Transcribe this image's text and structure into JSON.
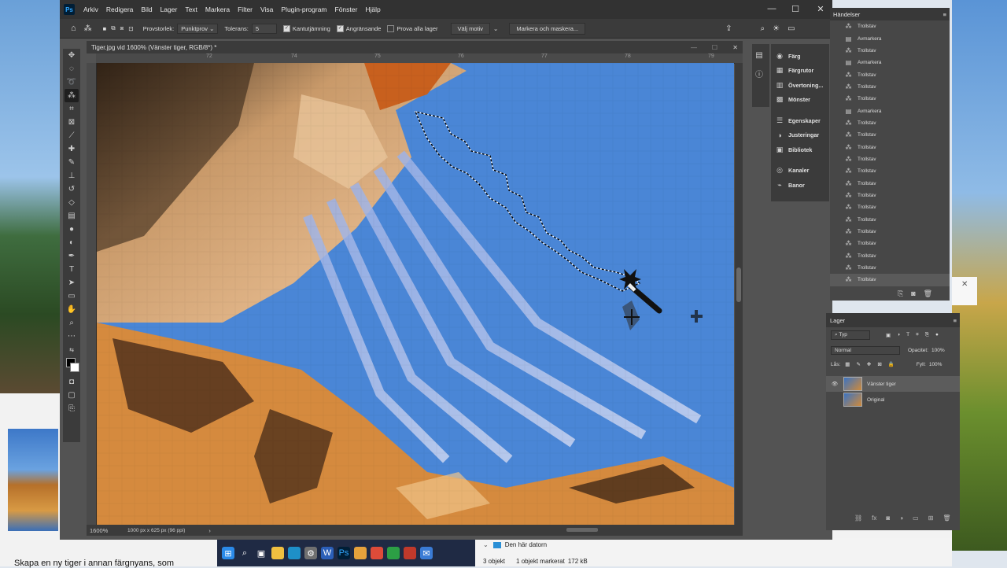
{
  "desktop": {
    "web_caption": "Skapa en ny tiger i annan färgnyans, som"
  },
  "taskbar": {
    "icons": [
      "windows-start-icon",
      "search-icon",
      "task-view-icon",
      "file-explorer-icon",
      "edge-icon",
      "settings-icon",
      "word-icon",
      "photoshop-icon",
      "folder-icon",
      "chrome-icon",
      "store-icon",
      "app-icon",
      "mail-icon"
    ]
  },
  "explorer": {
    "tree_item": "Den här datorn",
    "count": "3 objekt",
    "selected": "1 objekt markerat",
    "size": "172 kB"
  },
  "photoshop": {
    "menu": [
      "Arkiv",
      "Redigera",
      "Bild",
      "Lager",
      "Text",
      "Markera",
      "Filter",
      "Visa",
      "Plugin-program",
      "Fönster",
      "Hjälp"
    ],
    "options": {
      "sample_size_label": "Provstorlek:",
      "sample_size_value": "Punktprov",
      "tolerance_label": "Tolerans:",
      "tolerance_value": "5",
      "anti_alias": "Kantutjämning",
      "anti_alias_checked": true,
      "contiguous": "Angränsande",
      "contiguous_checked": true,
      "sample_all": "Prova alla lager",
      "sample_all_checked": false,
      "select_subject": "Välj motiv",
      "select_mask": "Markera och maskera..."
    },
    "document": {
      "title": "Tiger.jpg vid 1600% (Vänster tiger, RGB/8*) *",
      "zoom": "1600%",
      "doc_info": "1000 px x 625 px (96 ppi)",
      "ruler_ticks": [
        "72",
        "73",
        "74",
        "75",
        "76",
        "77",
        "78",
        "79"
      ]
    },
    "side_panels": [
      {
        "icon": "color-icon",
        "label": "Färg"
      },
      {
        "icon": "swatches-icon",
        "label": "Färgrutor"
      },
      {
        "icon": "gradients-icon",
        "label": "Övertoning..."
      },
      {
        "icon": "patterns-icon",
        "label": "Mönster"
      },
      {
        "icon": "properties-icon",
        "label": "Egenskaper"
      },
      {
        "icon": "adjustments-icon",
        "label": "Justeringar"
      },
      {
        "icon": "libraries-icon",
        "label": "Bibliotek"
      },
      {
        "icon": "channels-icon",
        "label": "Kanaler"
      },
      {
        "icon": "paths-icon",
        "label": "Banor"
      }
    ],
    "history": {
      "title": "Händelser",
      "items": [
        "Trollstav",
        "Avmarkera",
        "Trollstav",
        "Avmarkera",
        "Trollstav",
        "Trollstav",
        "Trollstav",
        "Avmarkera",
        "Trollstav",
        "Trollstav",
        "Trollstav",
        "Trollstav",
        "Trollstav",
        "Trollstav",
        "Trollstav",
        "Trollstav",
        "Trollstav",
        "Trollstav",
        "Trollstav",
        "Trollstav",
        "Trollstav",
        "Trollstav"
      ]
    },
    "layers": {
      "title": "Lager",
      "filter": "Typ",
      "blend_mode": "Normal",
      "opacity_label": "Opacitet:",
      "opacity_value": "100%",
      "lock_label": "Lås:",
      "fill_label": "Fyll:",
      "fill_value": "100%",
      "items": [
        {
          "name": "Vänster tiger",
          "selected": true,
          "visible": true
        },
        {
          "name": "Original",
          "selected": false,
          "visible": false
        }
      ]
    }
  }
}
